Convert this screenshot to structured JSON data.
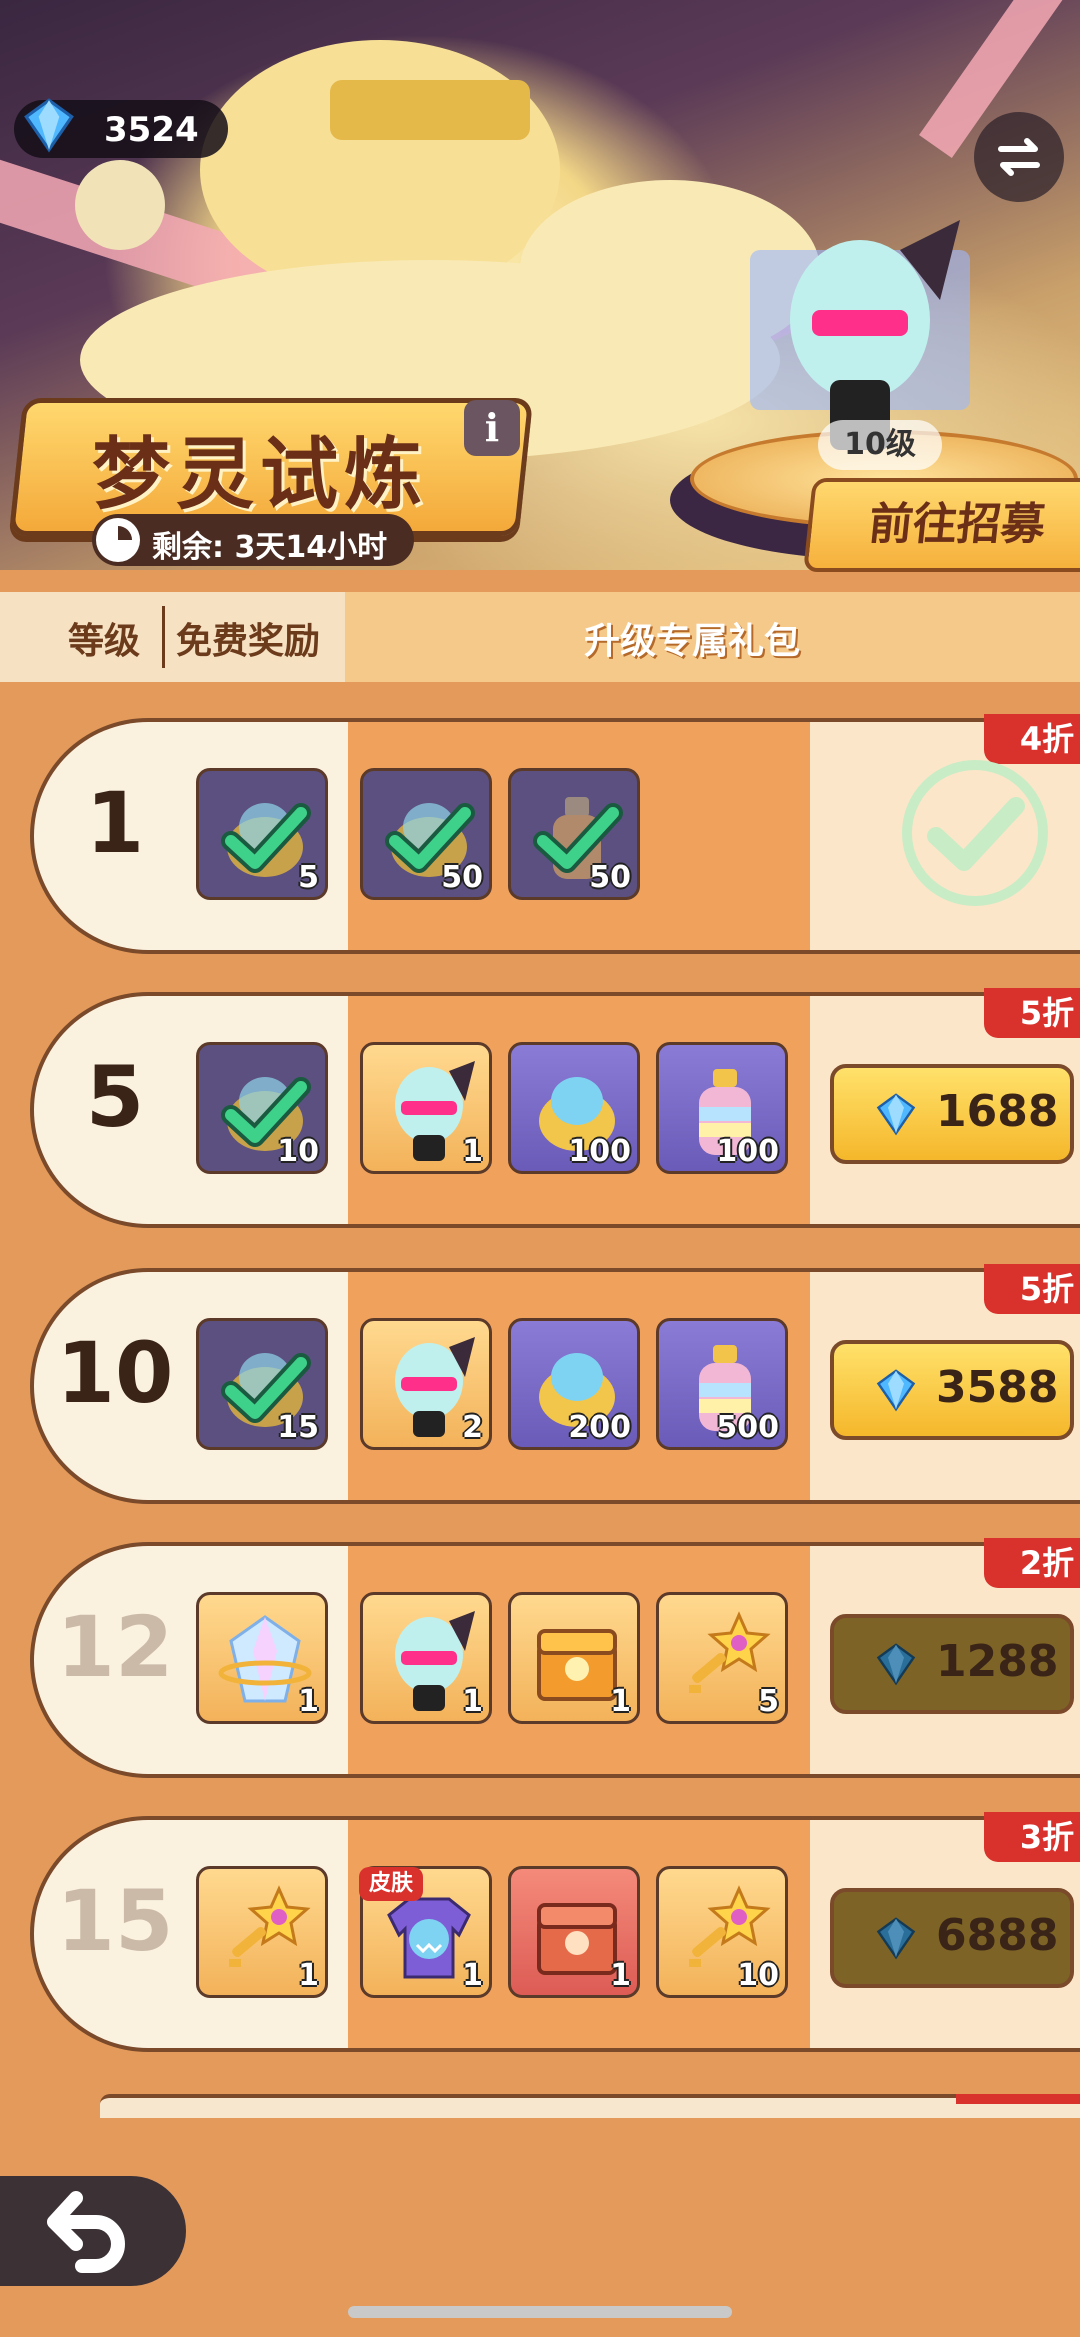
{
  "header": {
    "gems": "3524",
    "title": "梦灵试炼",
    "info_label": "i",
    "timer_text": "剩余: 3天14小时",
    "hero_level": "10级",
    "recruit_label": "前往招募"
  },
  "table_header": {
    "level": "等级",
    "free": "免费奖励",
    "pack": "升级专属礼包"
  },
  "rows": [
    {
      "level": "1",
      "discount": "4折",
      "free_qty": "5",
      "items": [
        "50",
        "50"
      ],
      "state": "claimed"
    },
    {
      "level": "5",
      "discount": "5折",
      "free_qty": "10",
      "items": [
        "1",
        "100",
        "100"
      ],
      "price": "1688"
    },
    {
      "level": "10",
      "discount": "5折",
      "free_qty": "15",
      "items": [
        "2",
        "200",
        "500"
      ],
      "price": "3588"
    },
    {
      "level": "12",
      "discount": "2折",
      "free_qty": "1",
      "items": [
        "1",
        "1",
        "5"
      ],
      "price": "1288"
    },
    {
      "level": "15",
      "discount": "3折",
      "free_qty": "1",
      "items": [
        "1",
        "1",
        "10"
      ],
      "price": "6888",
      "skin_tag": "皮肤"
    }
  ],
  "colors": {
    "accent_gold": "#f5b72b",
    "discount_red": "#d9322d",
    "text_brown": "#6b2f17"
  }
}
